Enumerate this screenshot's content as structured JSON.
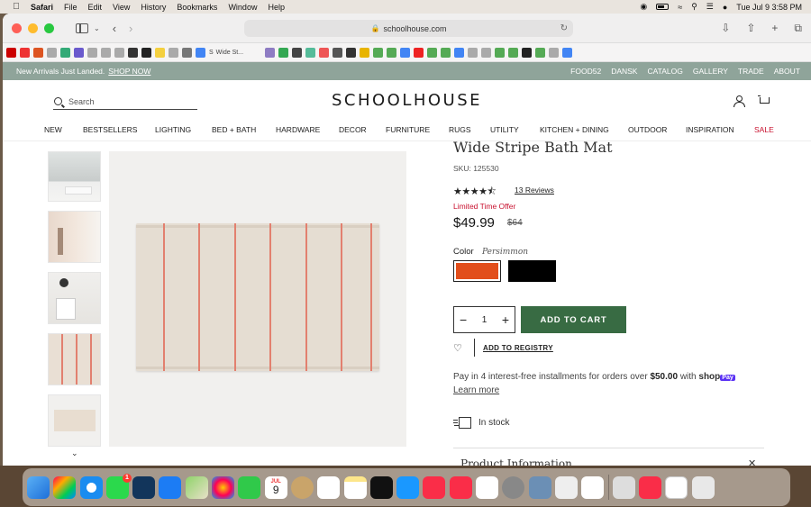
{
  "menubar": {
    "app_name": "Safari",
    "items": [
      "File",
      "Edit",
      "View",
      "History",
      "Bookmarks",
      "Window",
      "Help"
    ],
    "datetime": "Tue Jul 9  3:58 PM"
  },
  "browser": {
    "url": "schoolhouse.com",
    "tab_title": "Wide St..."
  },
  "announcement": {
    "text": "New Arrivals Just Landed.",
    "link": "SHOP NOW",
    "links": [
      "FOOD52",
      "DANSK",
      "CATALOG",
      "GALLERY",
      "TRADE",
      "ABOUT"
    ]
  },
  "header": {
    "logo": "SCHOOLHOUSE",
    "search_placeholder": "Search"
  },
  "nav": {
    "items": [
      "NEW",
      "BESTSELLERS",
      "LIGHTING",
      "BED + BATH",
      "HARDWARE",
      "DECOR",
      "FURNITURE",
      "RUGS",
      "UTILITY",
      "KITCHEN + DINING",
      "OUTDOOR",
      "INSPIRATION",
      "SALE"
    ]
  },
  "product": {
    "title": "Wide Stripe Bath Mat",
    "sku": "SKU: 125530",
    "rating_stars": "★★★★⯪",
    "rating": 4.5,
    "reviews": "13 Reviews",
    "offer": "Limited Time Offer",
    "price": "$49.99",
    "old_price": "$64",
    "color_label": "Color",
    "color_value": "Persimmon",
    "swatch_colors": [
      "#e24e1b",
      "#000000"
    ],
    "quantity": "1",
    "add_to_cart": "ADD TO CART",
    "registry": "ADD TO REGISTRY",
    "installments_text": "Pay in 4 interest-free installments for orders over",
    "installments_amount": "$50.00",
    "installments_with": "with",
    "shop_pay": "shop",
    "shop_pay_badge": "Pay",
    "learn_more": "Learn more",
    "stock": "In stock",
    "info_heading": "Product Information"
  },
  "dock": {
    "calendar_month": "JUL",
    "calendar_day": "9",
    "messages_badge": "1"
  },
  "colors": {
    "accent_green": "#386b43",
    "sale_red": "#c8102e",
    "announce_bg": "#8fa49a"
  }
}
